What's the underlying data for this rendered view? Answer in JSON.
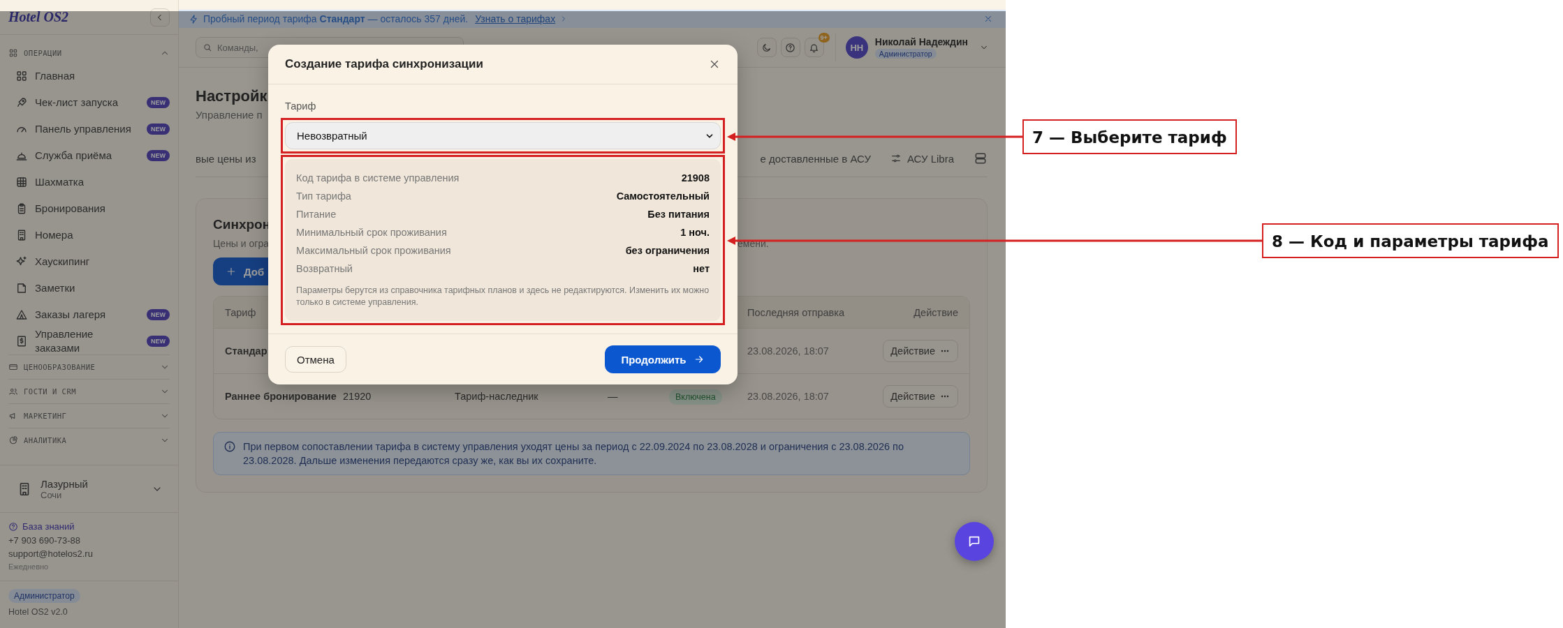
{
  "banner": {
    "text": "Пробный период тарифа **Стандарт** — осталось 357 дней.",
    "link": "Узнать о тарифах"
  },
  "sidebar": {
    "logo": "Hotel OS2",
    "sections": [
      {
        "title": "ОПЕРАЦИИ",
        "expanded": true,
        "items": [
          {
            "label": "Главная"
          },
          {
            "label": "Чек-лист запуска",
            "badge": "NEW"
          },
          {
            "label": "Панель управления",
            "badge": "NEW"
          },
          {
            "label": "Служба приёма",
            "badge": "NEW"
          },
          {
            "label": "Шахматка"
          },
          {
            "label": "Бронирования"
          },
          {
            "label": "Номера"
          },
          {
            "label": "Хаускипинг"
          },
          {
            "label": "Заметки"
          },
          {
            "label": "Заказы лагеря",
            "badge": "NEW"
          },
          {
            "label": "Управление заказами",
            "badge": "NEW"
          }
        ]
      },
      {
        "title": "ЦЕНООБРАЗОВАНИЕ",
        "expanded": false
      },
      {
        "title": "ГОСТИ И CRM",
        "expanded": false
      },
      {
        "title": "МАРКЕТИНГ",
        "expanded": false
      },
      {
        "title": "АНАЛИТИКА",
        "expanded": false
      }
    ],
    "hotel": {
      "name": "Лазурный",
      "city": "Сочи"
    },
    "help": {
      "link": "База знаний",
      "phone": "+7 903 690-73-88",
      "email": "support@hotelos2.ru",
      "hours": "Ежедневно"
    },
    "role": "Администратор",
    "version": "Hotel OS2 v2.0"
  },
  "topbar": {
    "search": {
      "placeholder": "Команды,"
    },
    "notifications": "9+",
    "user": {
      "initials": "НН",
      "name": "Николай Надеждин",
      "role": "Администратор"
    }
  },
  "page": {
    "title": "Настройк",
    "subtitle": "Управление п",
    "tabs": [
      {
        "label": "вые цены из"
      },
      {
        "label": "е доставленные в АСУ"
      },
      {
        "label": "АСУ Libra"
      }
    ],
    "card": {
      "title": "Синхрон",
      "description": "Цены и огра",
      "description_tail": "емени.",
      "add_button": "Доб",
      "table": {
        "columns": [
          "Тариф",
          "Последняя отправка",
          "Действие"
        ],
        "rows": [
          {
            "tariff": "Стандар",
            "last_sent": "23.08.2026, 18:07",
            "action": "Действие"
          },
          {
            "tariff": "Раннее бронирование",
            "code": "21920",
            "type": "Тариф-наследник",
            "parent": "—",
            "status": "Включена",
            "last_sent": "23.08.2026, 18:07",
            "action": "Действие"
          }
        ]
      },
      "info": "При первом сопоставлении тарифа в систему управления уходят цены за период с 22.09.2024 по 23.08.2028 и ограничения с 23.08.2026 по 23.08.2028. Дальше изменения передаются сразу же, как вы их сохраните."
    }
  },
  "modal": {
    "title": "Создание тарифа синхронизации",
    "field_label": "Тариф",
    "select_value": "Невозвратный",
    "params": [
      {
        "label": "Код тарифа в системе управления",
        "value": "21908"
      },
      {
        "label": "Тип тарифа",
        "value": "Самостоятельный"
      },
      {
        "label": "Питание",
        "value": "Без питания"
      },
      {
        "label": "Минимальный срок проживания",
        "value": "1 ноч."
      },
      {
        "label": "Максимальный срок проживания",
        "value": "без ограничения"
      },
      {
        "label": "Возвратный",
        "value": "нет"
      }
    ],
    "note": "Параметры берутся из справочника тарифных планов и здесь не редактируются. Изменить их можно только в системе управления.",
    "cancel": "Отмена",
    "continue": "Продолжить"
  },
  "annotations": [
    {
      "label": "7 — Выберите тариф"
    },
    {
      "label": "8 — Код и параметры тарифа"
    }
  ]
}
